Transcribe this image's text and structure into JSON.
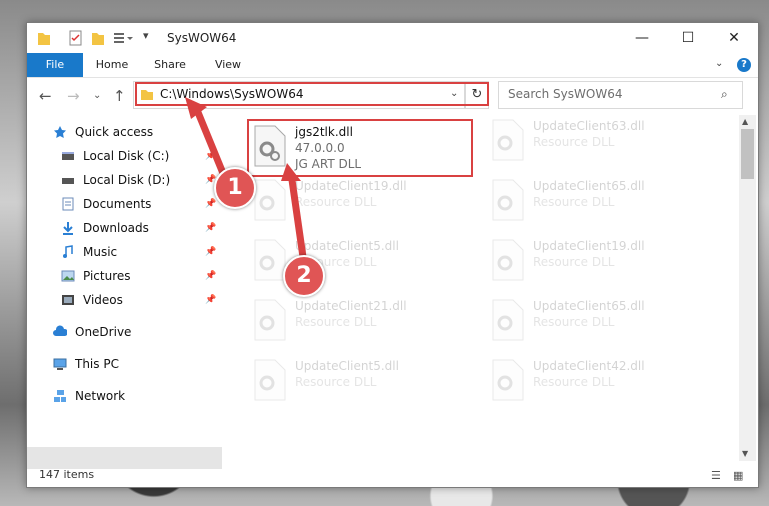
{
  "window": {
    "title": "SysWOW64",
    "controls": {
      "minimize": "—",
      "maximize": "☐",
      "close": "✕"
    }
  },
  "ribbon": {
    "tabs": [
      "File",
      "Home",
      "Share",
      "View"
    ],
    "help": "?"
  },
  "address": {
    "path": "C:\\Windows\\SysWOW64",
    "dropdown": "⌄",
    "refresh": "↻"
  },
  "search": {
    "placeholder": "Search SysWOW64",
    "icon": "search-icon"
  },
  "nav": {
    "quick_access": "Quick access",
    "items": [
      {
        "label": "Local Disk (C:)",
        "icon": "drive-icon",
        "pinned": true
      },
      {
        "label": "Local Disk (D:)",
        "icon": "drive-icon",
        "pinned": true
      },
      {
        "label": "Documents",
        "icon": "documents-icon",
        "pinned": true
      },
      {
        "label": "Downloads",
        "icon": "downloads-icon",
        "pinned": true
      },
      {
        "label": "Music",
        "icon": "music-icon",
        "pinned": true
      },
      {
        "label": "Pictures",
        "icon": "pictures-icon",
        "pinned": true
      },
      {
        "label": "Videos",
        "icon": "videos-icon",
        "pinned": true
      }
    ],
    "onedrive": "OneDrive",
    "this_pc": "This PC",
    "network": "Network"
  },
  "files": {
    "selected": {
      "name": "jgs2tlk.dll",
      "version": "47.0.0.0",
      "description": "JG ART DLL"
    },
    "left_column": [
      {
        "name": "UpdateClient19.dll",
        "type": "Resource DLL"
      },
      {
        "name": "UpdateClient5.dll",
        "type": "Resource DLL"
      },
      {
        "name": "UpdateClient21.dll",
        "type": "Resource DLL"
      },
      {
        "name": "UpdateClient5.dll",
        "type": "Resource DLL"
      }
    ],
    "right_column": [
      {
        "name": "UpdateClient63.dll",
        "type": "Resource DLL"
      },
      {
        "name": "UpdateClient65.dll",
        "type": "Resource DLL"
      },
      {
        "name": "UpdateClient19.dll",
        "type": "Resource DLL"
      },
      {
        "name": "UpdateClient65.dll",
        "type": "Resource DLL"
      },
      {
        "name": "UpdateClient42.dll",
        "type": "Resource DLL"
      }
    ]
  },
  "status": {
    "item_count": "147 items"
  },
  "annotations": {
    "step1": "1",
    "step2": "2",
    "color": "#d94141"
  }
}
